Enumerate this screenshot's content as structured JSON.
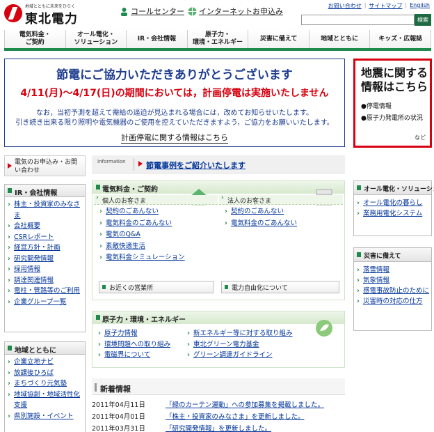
{
  "header": {
    "logo_tagline": "地域とともに未来をひらく",
    "logo_name": "東北電力",
    "call_center": "コールセンター",
    "internet_apply": "インターネットお申込み",
    "util_links": [
      "お問い合わせ",
      "サイトマップ",
      "English"
    ],
    "search_button": "検索",
    "search_value": ""
  },
  "gnav": [
    "電気料金・\nご契約",
    "オール電化・\nソリューション",
    "IR・会社情報",
    "原子力・\n環境・エネルギー",
    "災害に備えて",
    "地域とともに",
    "キッズ・広報誌"
  ],
  "banner": {
    "line1": "節電にご協力いただきありがとうございます",
    "line2": "4/11(月)～4/17(日)の期間においては，計画停電は実施いたしません",
    "line3": "なお，当初予測を超えて需給の逼迫が見込まれる場合には，改めてお知らせいたします。",
    "line4": "引き続き出来る限り照明や電気機器のご使用を控えていただきますよう，ご協力をお願いいたします。",
    "line5": "計画停電に関する情報はこちら"
  },
  "quake": {
    "title": "地震に関する情報はこちら",
    "items": [
      "●停電情報",
      "●原子力発電所の状況"
    ],
    "etc": "など"
  },
  "left": {
    "apply": "電気のお申込み・お問い合わせ",
    "ir_title": "IR・会社情報",
    "ir_items": [
      "株主・投資家のみなさま",
      "会社概要",
      "CSRレポート",
      "経営方針・計画",
      "研究開発情報",
      "採用情報",
      "調達関連情報",
      "電柱・管路等のご利用",
      "企業グループ一覧"
    ],
    "region_title": "地域とともに",
    "region_items": [
      "企業立地ナビ",
      "放課後ひろば",
      "まちづくり元気塾",
      "地域協創・地域活性化支援",
      "県別施設・イベント"
    ]
  },
  "info": {
    "label": "Information",
    "text": "節電事例をご紹介いたします"
  },
  "rates": {
    "title": "電気料金・ご契約",
    "personal_title": "個人のお客さま",
    "personal_items": [
      "契約のごあんない",
      "電気料金のごあんない",
      "電気のQ&A",
      "素敵快適生活",
      "電気料金シミュレーション"
    ],
    "corp_title": "法人のお客さま",
    "corp_items": [
      "契約のごあんない",
      "電気料金のごあんない"
    ],
    "office": "お近くの営業所",
    "liberal": "電力自由化について"
  },
  "nuclear": {
    "title": "原子力・環境・エネルギー",
    "col1": [
      "原子力情報",
      "環境問題への取り組み",
      "電磁界について"
    ],
    "col2": [
      "新エネルギー等に対する取り組み",
      "東北グリーン電力基金",
      "グリーン調達ガイドライン"
    ]
  },
  "news": {
    "title": "新着情報",
    "rows": [
      {
        "date": "2011年04月11日",
        "text": "「緑のカーテン運動」への参加募集を掲載しました。"
      },
      {
        "date": "2011年04月01日",
        "text": "「株主・投資家のみなさま」を更新しました。"
      },
      {
        "date": "2011年03月31日",
        "text": "「研究開発情報」を更新しました。"
      }
    ]
  },
  "right": {
    "allelec_title": "オール電化・ソリューション",
    "allelec_items": [
      "オール電化の暮らし",
      "業務用電化システム"
    ],
    "disaster_title": "災害に備えて",
    "disaster_items": [
      "落雷情報",
      "気象情報",
      "感電事故防止のために",
      "災害時の対応の仕方"
    ]
  },
  "colors": {
    "brand_green": "#1e8a4c",
    "alert_red": "#d7000f",
    "banner_blue": "#1e3d8f"
  }
}
